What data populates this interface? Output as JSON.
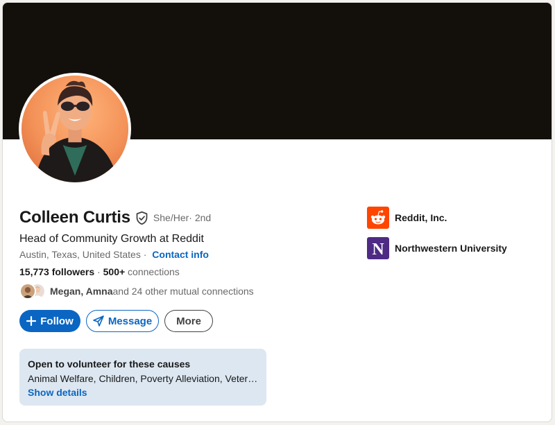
{
  "profile": {
    "name": "Colleen Curtis",
    "pronouns": "She/Her",
    "degree": " · 2nd",
    "headline": "Head of Community Growth at Reddit",
    "location": "Austin, Texas, United States",
    "location_sep": " · ",
    "contact_label": "Contact info",
    "followers": "15,773 followers",
    "stats_sep": " · ",
    "connections_count": "500+",
    "connections_label": " connections",
    "mutual_names": "Megan, Amna",
    "mutual_rest": " and 24 other mutual connections"
  },
  "actions": {
    "follow_label": "Follow",
    "message_label": "Message",
    "more_label": "More"
  },
  "volunteer": {
    "title": "Open to volunteer for these causes",
    "causes": "Animal Welfare, Children, Poverty Alleviation, Veteran Support",
    "link_label": "Show details"
  },
  "organizations": [
    {
      "name": "Reddit, Inc.",
      "logo_icon": "reddit-logo-icon"
    },
    {
      "name": "Northwestern University",
      "logo_icon": "northwestern-logo-icon",
      "logo_letter": "N"
    }
  ],
  "colors": {
    "banner": "#13100c",
    "accent": "#0a66c2",
    "volunteer_bg": "#dde7f1",
    "reddit_orange": "#ff4500",
    "northwestern_purple": "#4e2a84"
  }
}
